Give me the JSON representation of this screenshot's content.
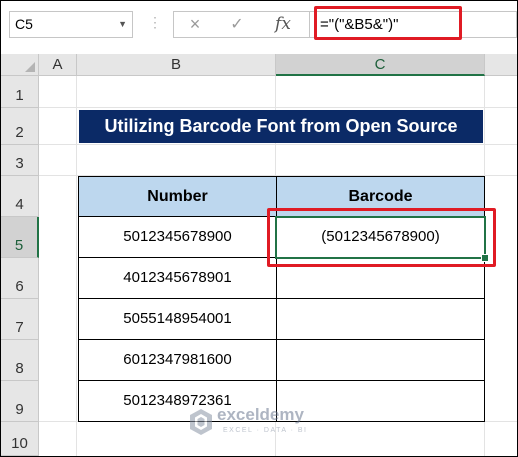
{
  "formula_bar": {
    "name_box": "C5",
    "cancel_icon": "×",
    "enter_icon": "✓",
    "fx_label": "fx",
    "formula": "=\"(\"&B5&\")\""
  },
  "columns": [
    "A",
    "B",
    "C"
  ],
  "rows": [
    "1",
    "2",
    "3",
    "4",
    "5",
    "6",
    "7",
    "8",
    "9",
    "10"
  ],
  "selected_cell": "C5",
  "title": "Utilizing Barcode Font from Open Source",
  "table": {
    "headers": [
      "Number",
      "Barcode"
    ],
    "rows": [
      {
        "number": "5012345678900",
        "barcode": "(5012345678900)"
      },
      {
        "number": "4012345678901",
        "barcode": ""
      },
      {
        "number": "5055148954001",
        "barcode": ""
      },
      {
        "number": "6012347981600",
        "barcode": ""
      },
      {
        "number": "5012348972361",
        "barcode": ""
      }
    ]
  },
  "watermark": {
    "name": "exceldemy",
    "tagline": "EXCEL · DATA · BI"
  },
  "colors": {
    "title_bg": "#0b2a66",
    "header_bg": "#bdd7ee",
    "highlight": "#e01b24",
    "selection": "#217346"
  }
}
